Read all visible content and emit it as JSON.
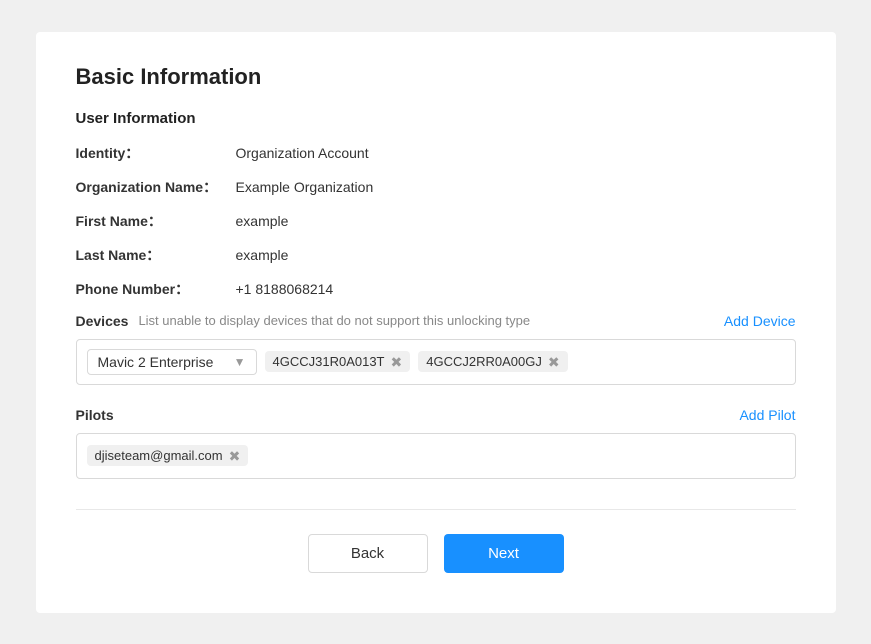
{
  "page": {
    "title": "Basic Information",
    "section": {
      "user_info_heading": "User Information",
      "identity_label": "Identity：",
      "identity_value": "Organization Account",
      "org_name_label": "Organization Name：",
      "org_name_value": "Example Organization",
      "first_name_label": "First Name：",
      "first_name_value": "example",
      "last_name_label": "Last Name：",
      "last_name_value": "example",
      "phone_label": "Phone Number：",
      "phone_value": "+1 8188068214"
    },
    "devices": {
      "label": "Devices",
      "hint": "List unable to display devices that do not support this unlocking type",
      "add_link": "Add Device",
      "selected_model": "Mavic 2 Enterprise",
      "tags": [
        {
          "id": "tag-1",
          "value": "4GCCJ31R0A013T"
        },
        {
          "id": "tag-2",
          "value": "4GCCJ2RR0A00GJ"
        }
      ]
    },
    "pilots": {
      "label": "Pilots",
      "add_link": "Add Pilot",
      "tags": [
        {
          "id": "pilot-1",
          "value": "djiseteam@gmail.com"
        }
      ]
    },
    "actions": {
      "back_label": "Back",
      "next_label": "Next"
    }
  }
}
